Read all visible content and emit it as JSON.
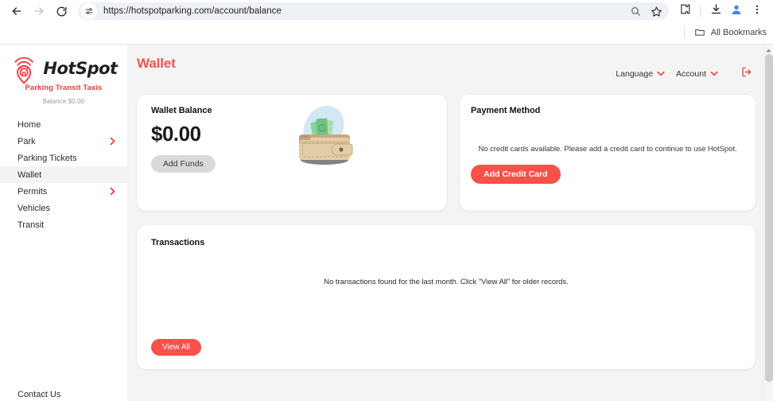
{
  "browser": {
    "back_icon": "back-arrow-icon",
    "forward_icon": "forward-arrow-icon",
    "reload_icon": "reload-icon",
    "site_settings_icon": "tune-icon",
    "url": "https://hotspotparking.com/account/balance",
    "search_icon": "search-icon",
    "bookmark_icon": "star-icon",
    "extensions_icon": "puzzle-piece-icon",
    "downloads_icon": "download-icon",
    "profile_icon": "profile-avatar-icon",
    "menu_icon": "three-dot-menu-icon",
    "bookmarks": {
      "folder_icon": "folder-icon",
      "label": "All Bookmarks"
    }
  },
  "sidebar": {
    "brand": {
      "logo_icon": "hotspot-pin-wifi-logo",
      "name": "HotSpot",
      "tagline": "Parking Transit Taxis",
      "balance": "Balance $0.00"
    },
    "items": [
      {
        "label": "Home",
        "chevron": false,
        "active": false
      },
      {
        "label": "Park",
        "chevron": true,
        "active": false
      },
      {
        "label": "Parking Tickets",
        "chevron": false,
        "active": false
      },
      {
        "label": "Wallet",
        "chevron": false,
        "active": true
      },
      {
        "label": "Permits",
        "chevron": true,
        "active": false
      },
      {
        "label": "Vehicles",
        "chevron": false,
        "active": false
      },
      {
        "label": "Transit",
        "chevron": false,
        "active": false
      }
    ],
    "footer": {
      "label": "Contact Us"
    }
  },
  "header": {
    "title": "Wallet",
    "language_label": "Language",
    "account_label": "Account",
    "chevron_icon": "chevron-down-icon",
    "logout_icon": "logout-icon"
  },
  "wallet_balance_card": {
    "title": "Wallet Balance",
    "amount": "$0.00",
    "add_funds_label": "Add Funds",
    "illustration": "wallet-with-cash-illustration"
  },
  "payment_method_card": {
    "title": "Payment Method",
    "empty_message": "No credit cards available. Please add a credit card to continue to use HotSpot.",
    "add_card_label": "Add Credit Card"
  },
  "transactions_card": {
    "title": "Transactions",
    "empty_message": "No transactions found for the last month. Click \"View All\" for older records.",
    "view_all_label": "View All"
  },
  "scrollbar": {
    "up_arrow_icon": "scroll-up-arrow-icon"
  },
  "colors": {
    "brand_red": "#f9504a",
    "logo_red": "#ee3b3b",
    "page_bg": "#f4f4f5",
    "card_bg": "#ffffff",
    "text_dark": "#1b1b1b",
    "muted": "#9b9b9b"
  }
}
